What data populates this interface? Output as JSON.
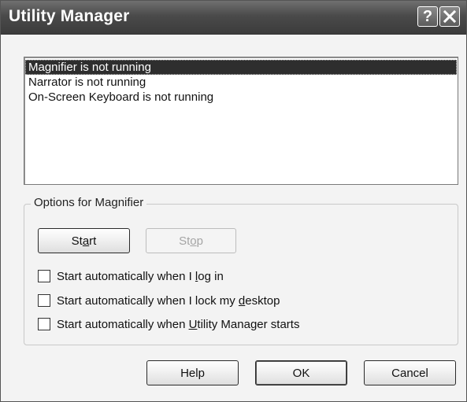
{
  "window": {
    "title": "Utility Manager",
    "help_glyph": "?"
  },
  "utilities": [
    {
      "label": "Magnifier is not running",
      "selected": true
    },
    {
      "label": "Narrator is not running",
      "selected": false
    },
    {
      "label": "On-Screen Keyboard is not running",
      "selected": false
    }
  ],
  "options": {
    "legend": "Options for Magnifier",
    "start": {
      "pre": "St",
      "accel": "a",
      "post": "rt",
      "enabled": true
    },
    "stop": {
      "pre": "St",
      "accel": "o",
      "post": "p",
      "enabled": false
    },
    "checkboxes": [
      {
        "pre": "Start automatically when I ",
        "accel": "l",
        "post": "og in",
        "checked": false
      },
      {
        "pre": "Start automatically when I lock my ",
        "accel": "d",
        "post": "esktop",
        "checked": false
      },
      {
        "pre": "Start automatically when ",
        "accel": "U",
        "post": "tility Manager starts",
        "checked": false
      }
    ]
  },
  "footer": {
    "help_label": "Help",
    "ok_label": "OK",
    "cancel_label": "Cancel"
  }
}
